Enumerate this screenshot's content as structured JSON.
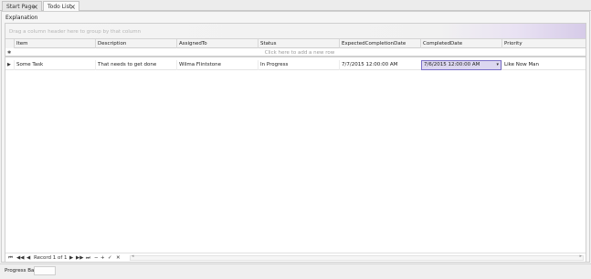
{
  "tabs": [
    {
      "label": "Start Page",
      "close": "×"
    },
    {
      "label": "Todo List",
      "close": "×"
    }
  ],
  "panel": {
    "title": "Explanation"
  },
  "grid": {
    "group_panel_hint": "Drag a column header here to group by that column",
    "columns": [
      "Item",
      "Description",
      "AssignedTo",
      "Status",
      "ExpectedCompletionDate",
      "CompletedDate",
      "Priority"
    ],
    "new_row_marker": "✱",
    "new_row_text": "Click here to add a new row",
    "row_pointer": "▶",
    "rows": [
      {
        "Item": "Some Task",
        "Description": "That needs to get done",
        "AssignedTo": "Wilma Flintstone",
        "Status": "In Progress",
        "ExpectedCompletionDate": "7/7/2015 12:00:00 AM",
        "CompletedDate": "7/6/2015 12:00:00 AM",
        "Priority": "Like Now Man"
      }
    ],
    "editing_dropdown": "▾"
  },
  "navigator": {
    "first": "⏮",
    "prev_page": "◀◀",
    "prev": "◀",
    "record_text": "Record 1 of 1",
    "next": "▶",
    "next_page": "▶▶",
    "last": "⏭",
    "remove": "−",
    "add": "+",
    "apply": "✓",
    "cancel": "✕",
    "scroll_left": "◂",
    "scroll_right": "▸"
  },
  "status": {
    "progress_label": "Progress Bar",
    "progress_value": 0
  }
}
